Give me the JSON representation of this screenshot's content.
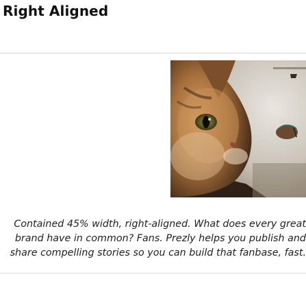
{
  "section": {
    "title": "Right Aligned"
  },
  "figure": {
    "image_icon": "cat-photo",
    "caption": "Contained 45% width, right-aligned. What does every great brand have in common? Fans. Prezly helps you publish and share compelling stories so you can build that fanbase, fast."
  }
}
